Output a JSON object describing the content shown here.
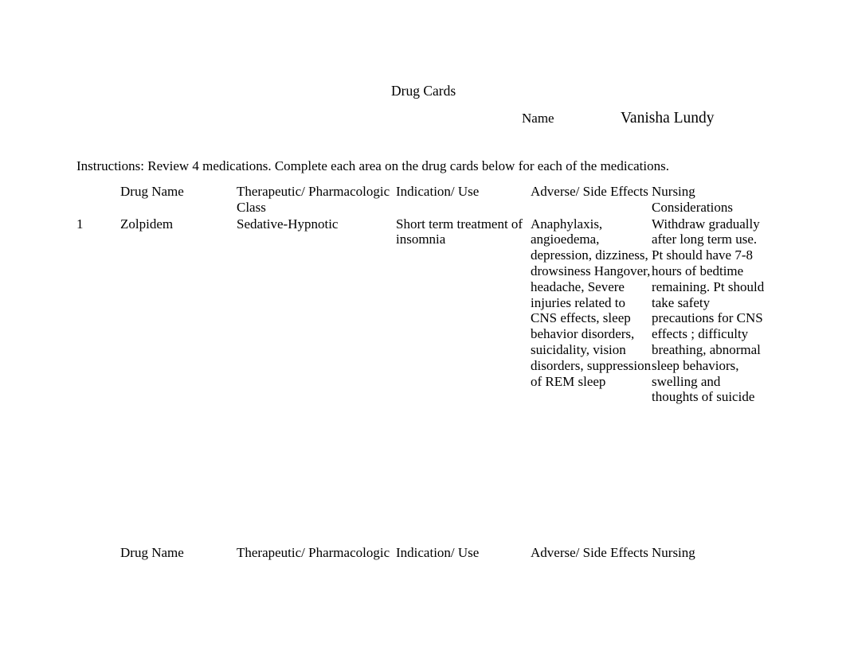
{
  "document": {
    "title": "Drug Cards",
    "name_label": "Name",
    "name_value": "Vanisha Lundy",
    "instructions": "Instructions: Review 4 medications.  Complete each area on the drug cards below for each of the medications."
  },
  "table": {
    "headers": {
      "number": "",
      "drug_name": "Drug Name",
      "class": "Therapeutic/ Pharmacologic Class",
      "indication": "Indication/ Use",
      "adverse": "Adverse/ Side Effects",
      "nursing": "Nursing Considerations"
    },
    "rows": [
      {
        "number": "1",
        "drug_name": "Zolpidem",
        "class": "Sedative-Hypnotic",
        "indication": "Short term treatment of insomnia",
        "adverse": "Anaphylaxis, angioedema, depression, dizziness, drowsiness Hangover, headache, Severe injuries related to CNS effects, sleep behavior disorders, suicidality, vision disorders, suppression of REM sleep",
        "nursing": "Withdraw gradually after long term use. Pt should have 7-8 hours of bedtime remaining. Pt should take safety precautions for CNS effects ; difficulty breathing, abnormal sleep behaviors, swelling and thoughts of suicide"
      }
    ],
    "repeated_headers": {
      "number": "",
      "drug_name": "Drug Name",
      "class": "Therapeutic/ Pharmacologic",
      "indication": "Indication/ Use",
      "adverse": "Adverse/ Side Effects",
      "nursing": "Nursing"
    }
  }
}
